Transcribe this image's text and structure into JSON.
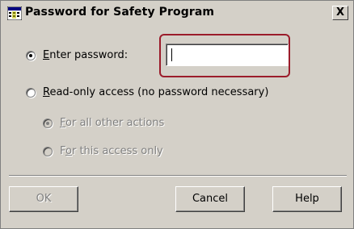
{
  "window": {
    "title": "Password for Safety Program",
    "close_label": "X"
  },
  "options": {
    "enter_password": {
      "prefix": "E",
      "rest": "nter password:",
      "checked": true
    },
    "read_only": {
      "prefix": "R",
      "rest": "ead-only access (no password necessary)",
      "checked": false
    },
    "all_other": {
      "prefix": "F",
      "rest": "or all other actions",
      "checked": true,
      "enabled": false
    },
    "this_access": {
      "before": "F",
      "accel": "o",
      "after": "r this access only",
      "checked": false,
      "enabled": false
    }
  },
  "password_field": {
    "value": ""
  },
  "buttons": {
    "ok": "OK",
    "cancel": "Cancel",
    "help": "Help"
  },
  "colors": {
    "highlight_frame": "#9b1c2b",
    "dialog_bg": "#d4d0c8"
  },
  "icons": {
    "title": "program-grid-icon"
  }
}
